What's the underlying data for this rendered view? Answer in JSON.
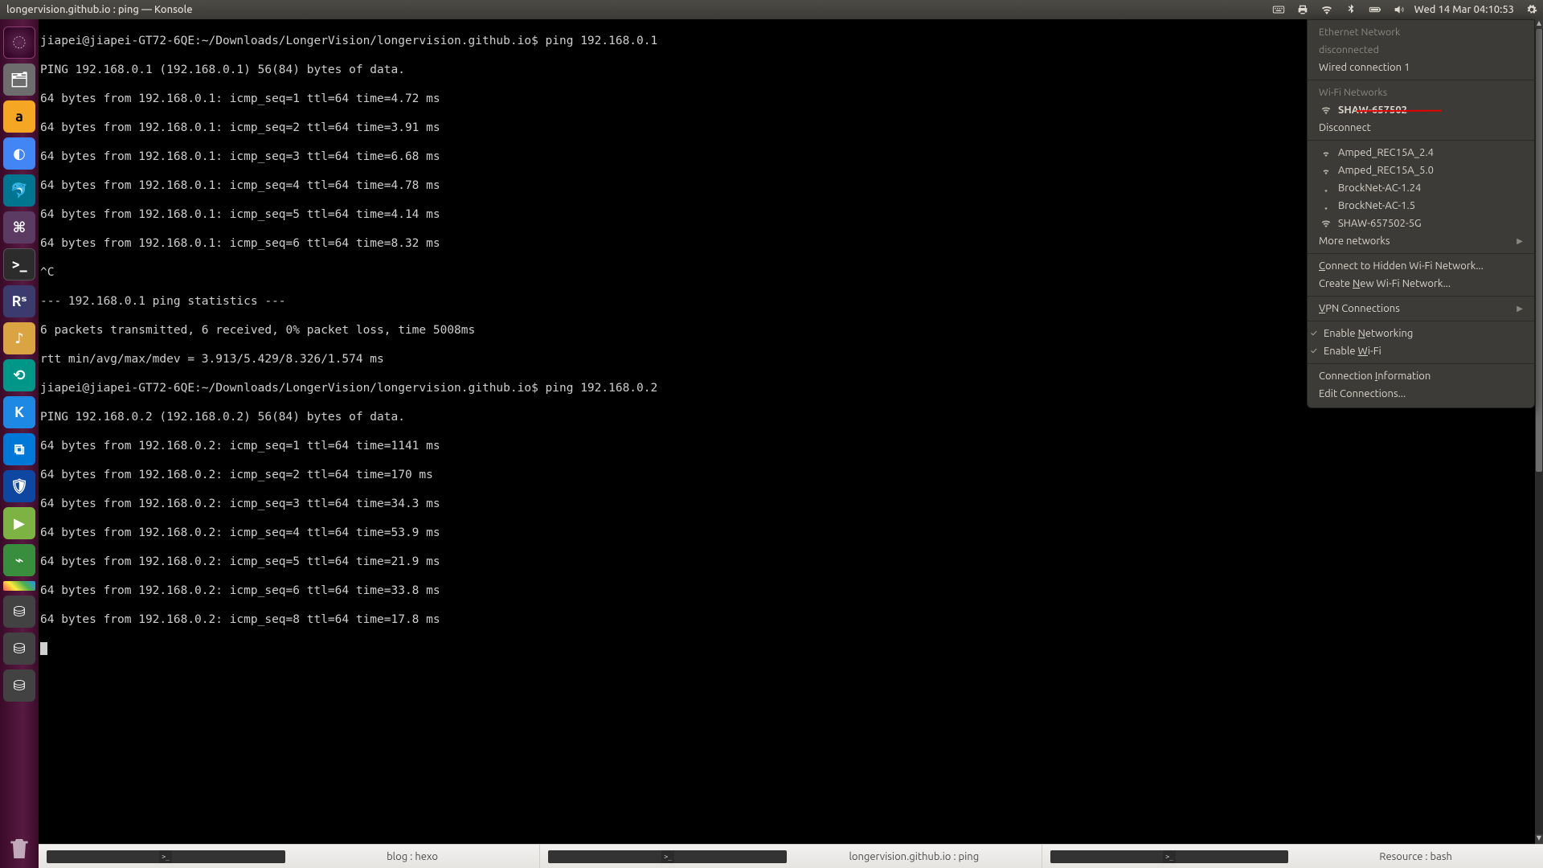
{
  "top": {
    "title": "longervision.github.io : ping — Konsole",
    "datetime": "Wed 14 Mar 04:10:53"
  },
  "launcher": {
    "tiles": [
      {
        "name": "dash",
        "glyph": "◌"
      },
      {
        "name": "files",
        "glyph": "🗂"
      },
      {
        "name": "amazon",
        "glyph": "a"
      },
      {
        "name": "chromium",
        "glyph": "◐"
      },
      {
        "name": "mysql-workbench",
        "glyph": "🐬"
      },
      {
        "name": "k-app",
        "glyph": "⌘"
      },
      {
        "name": "terminal",
        "glyph": ">_"
      },
      {
        "name": "rstudio",
        "glyph": "Rˢ"
      },
      {
        "name": "yellow-app",
        "glyph": "♪"
      },
      {
        "name": "teal-app",
        "glyph": "⟲"
      },
      {
        "name": "k-circle",
        "glyph": "K"
      },
      {
        "name": "vscode",
        "glyph": "⧉"
      },
      {
        "name": "shield",
        "glyph": "🛡"
      },
      {
        "name": "green-play",
        "glyph": "▶"
      },
      {
        "name": "wireshark",
        "glyph": "⌁"
      },
      {
        "name": "color-strip",
        "glyph": ""
      },
      {
        "name": "drive-1",
        "glyph": "⛁"
      },
      {
        "name": "drive-2",
        "glyph": "⛁"
      },
      {
        "name": "drive-3",
        "glyph": "⛁"
      }
    ]
  },
  "terminal": {
    "lines": [
      "jiapei@jiapei-GT72-6QE:~/Downloads/LongerVision/longervision.github.io$ ping 192.168.0.1",
      "PING 192.168.0.1 (192.168.0.1) 56(84) bytes of data.",
      "64 bytes from 192.168.0.1: icmp_seq=1 ttl=64 time=4.72 ms",
      "64 bytes from 192.168.0.1: icmp_seq=2 ttl=64 time=3.91 ms",
      "64 bytes from 192.168.0.1: icmp_seq=3 ttl=64 time=6.68 ms",
      "64 bytes from 192.168.0.1: icmp_seq=4 ttl=64 time=4.78 ms",
      "64 bytes from 192.168.0.1: icmp_seq=5 ttl=64 time=4.14 ms",
      "64 bytes from 192.168.0.1: icmp_seq=6 ttl=64 time=8.32 ms",
      "^C",
      "--- 192.168.0.1 ping statistics ---",
      "6 packets transmitted, 6 received, 0% packet loss, time 5008ms",
      "rtt min/avg/max/mdev = 3.913/5.429/8.326/1.574 ms",
      "jiapei@jiapei-GT72-6QE:~/Downloads/LongerVision/longervision.github.io$ ping 192.168.0.2",
      "PING 192.168.0.2 (192.168.0.2) 56(84) bytes of data.",
      "64 bytes from 192.168.0.2: icmp_seq=1 ttl=64 time=1141 ms",
      "64 bytes from 192.168.0.2: icmp_seq=2 ttl=64 time=170 ms",
      "64 bytes from 192.168.0.2: icmp_seq=3 ttl=64 time=34.3 ms",
      "64 bytes from 192.168.0.2: icmp_seq=4 ttl=64 time=53.9 ms",
      "64 bytes from 192.168.0.2: icmp_seq=5 ttl=64 time=21.9 ms",
      "64 bytes from 192.168.0.2: icmp_seq=6 ttl=64 time=33.8 ms",
      "64 bytes from 192.168.0.2: icmp_seq=8 ttl=64 time=17.8 ms"
    ]
  },
  "network_menu": {
    "ethernet_header": "Ethernet Network",
    "ethernet_status": "disconnected",
    "wired": "Wired connection 1",
    "wifi_header": "Wi-Fi Networks",
    "connected": "SHAW-657502",
    "disconnect": "Disconnect",
    "networks": [
      "Amped_REC15A_2.4",
      "Amped_REC15A_5.0",
      "BrockNet-AC-1.24",
      "BrockNet-AC-1.5",
      "SHAW-657502-5G"
    ],
    "more": "More networks",
    "connect_hidden": "Connect to Hidden Wi-Fi Network...",
    "create_new": "Create New Wi-Fi Network...",
    "vpn": "VPN Connections",
    "enable_net": "Enable Networking",
    "enable_wifi": "Enable Wi-Fi",
    "conn_info": "Connection Information",
    "edit_conn": "Edit Connections..."
  },
  "taskbar": {
    "items": [
      "blog : hexo",
      "longervision.github.io : ping",
      "Resource : bash"
    ]
  }
}
